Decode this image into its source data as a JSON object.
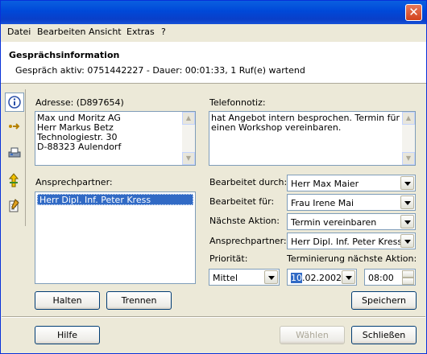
{
  "menubar": {
    "items": [
      "Datei",
      "Bearbeiten",
      "Ansicht",
      "Extras",
      "?"
    ]
  },
  "header": {
    "title": "Gesprächsinformation",
    "status": "Gespräch aktiv: 0751442227 - Dauer: 00:01:33, 1 Ruf(e) wartend"
  },
  "address": {
    "label": "Adresse: (D897654)",
    "text": "Max und Moritz AG\nHerr Markus Betz\nTechnologiestr. 30\nD-88323 Aulendorf"
  },
  "note": {
    "label": "Telefonnotiz:",
    "text": "hat Angebot intern besprochen. Termin für\neinen Workshop vereinbaren."
  },
  "contacts": {
    "label": "Ansprechpartner:",
    "items": [
      "Herr Dipl. Inf. Peter Kress"
    ]
  },
  "form": {
    "bearbeitet_durch": {
      "label": "Bearbeitet durch:",
      "value": "Herr Max Maier"
    },
    "bearbeitet_fuer": {
      "label": "Bearbeitet für:",
      "value": "Frau Irene Mai"
    },
    "naechste_aktion": {
      "label": "Nächste Aktion:",
      "value": "Termin vereinbaren"
    },
    "ansprechpartner": {
      "label": "Ansprechpartner:",
      "value": "Herr Dipl. Inf. Peter Kress"
    },
    "prioritaet": {
      "label": "Priorität:",
      "value": "Mittel"
    },
    "terminierung": {
      "label": "Terminierung nächste Aktion:",
      "date_day": "10",
      "date_rest": ".02.2002",
      "time": "08:00"
    }
  },
  "buttons": {
    "halten": "Halten",
    "trennen": "Trennen",
    "speichern": "Speichern",
    "hilfe": "Hilfe",
    "waehlen": "Wählen",
    "schliessen": "Schließen"
  },
  "icons": {
    "nav": [
      "info-icon",
      "dial-arrow-icon",
      "fax-icon",
      "transfer-arrows-icon",
      "notes-icon"
    ],
    "close": "close-icon"
  }
}
